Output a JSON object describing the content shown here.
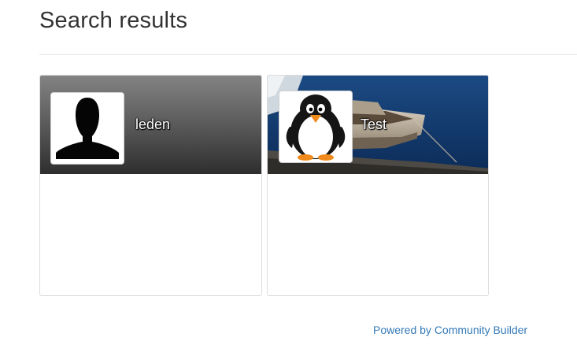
{
  "page": {
    "title": "Search results"
  },
  "results": [
    {
      "name": "leden",
      "avatar_icon": "default-silhouette-icon",
      "canvas": "dark-gradient"
    },
    {
      "name": "Test",
      "avatar_icon": "penguin-icon",
      "canvas": "boat-photo"
    }
  ],
  "footer": {
    "powered_by_label": "Powered by Community Builder"
  },
  "colors": {
    "link": "#337ab7",
    "title": "#333333",
    "divider": "#e6e6e6"
  }
}
